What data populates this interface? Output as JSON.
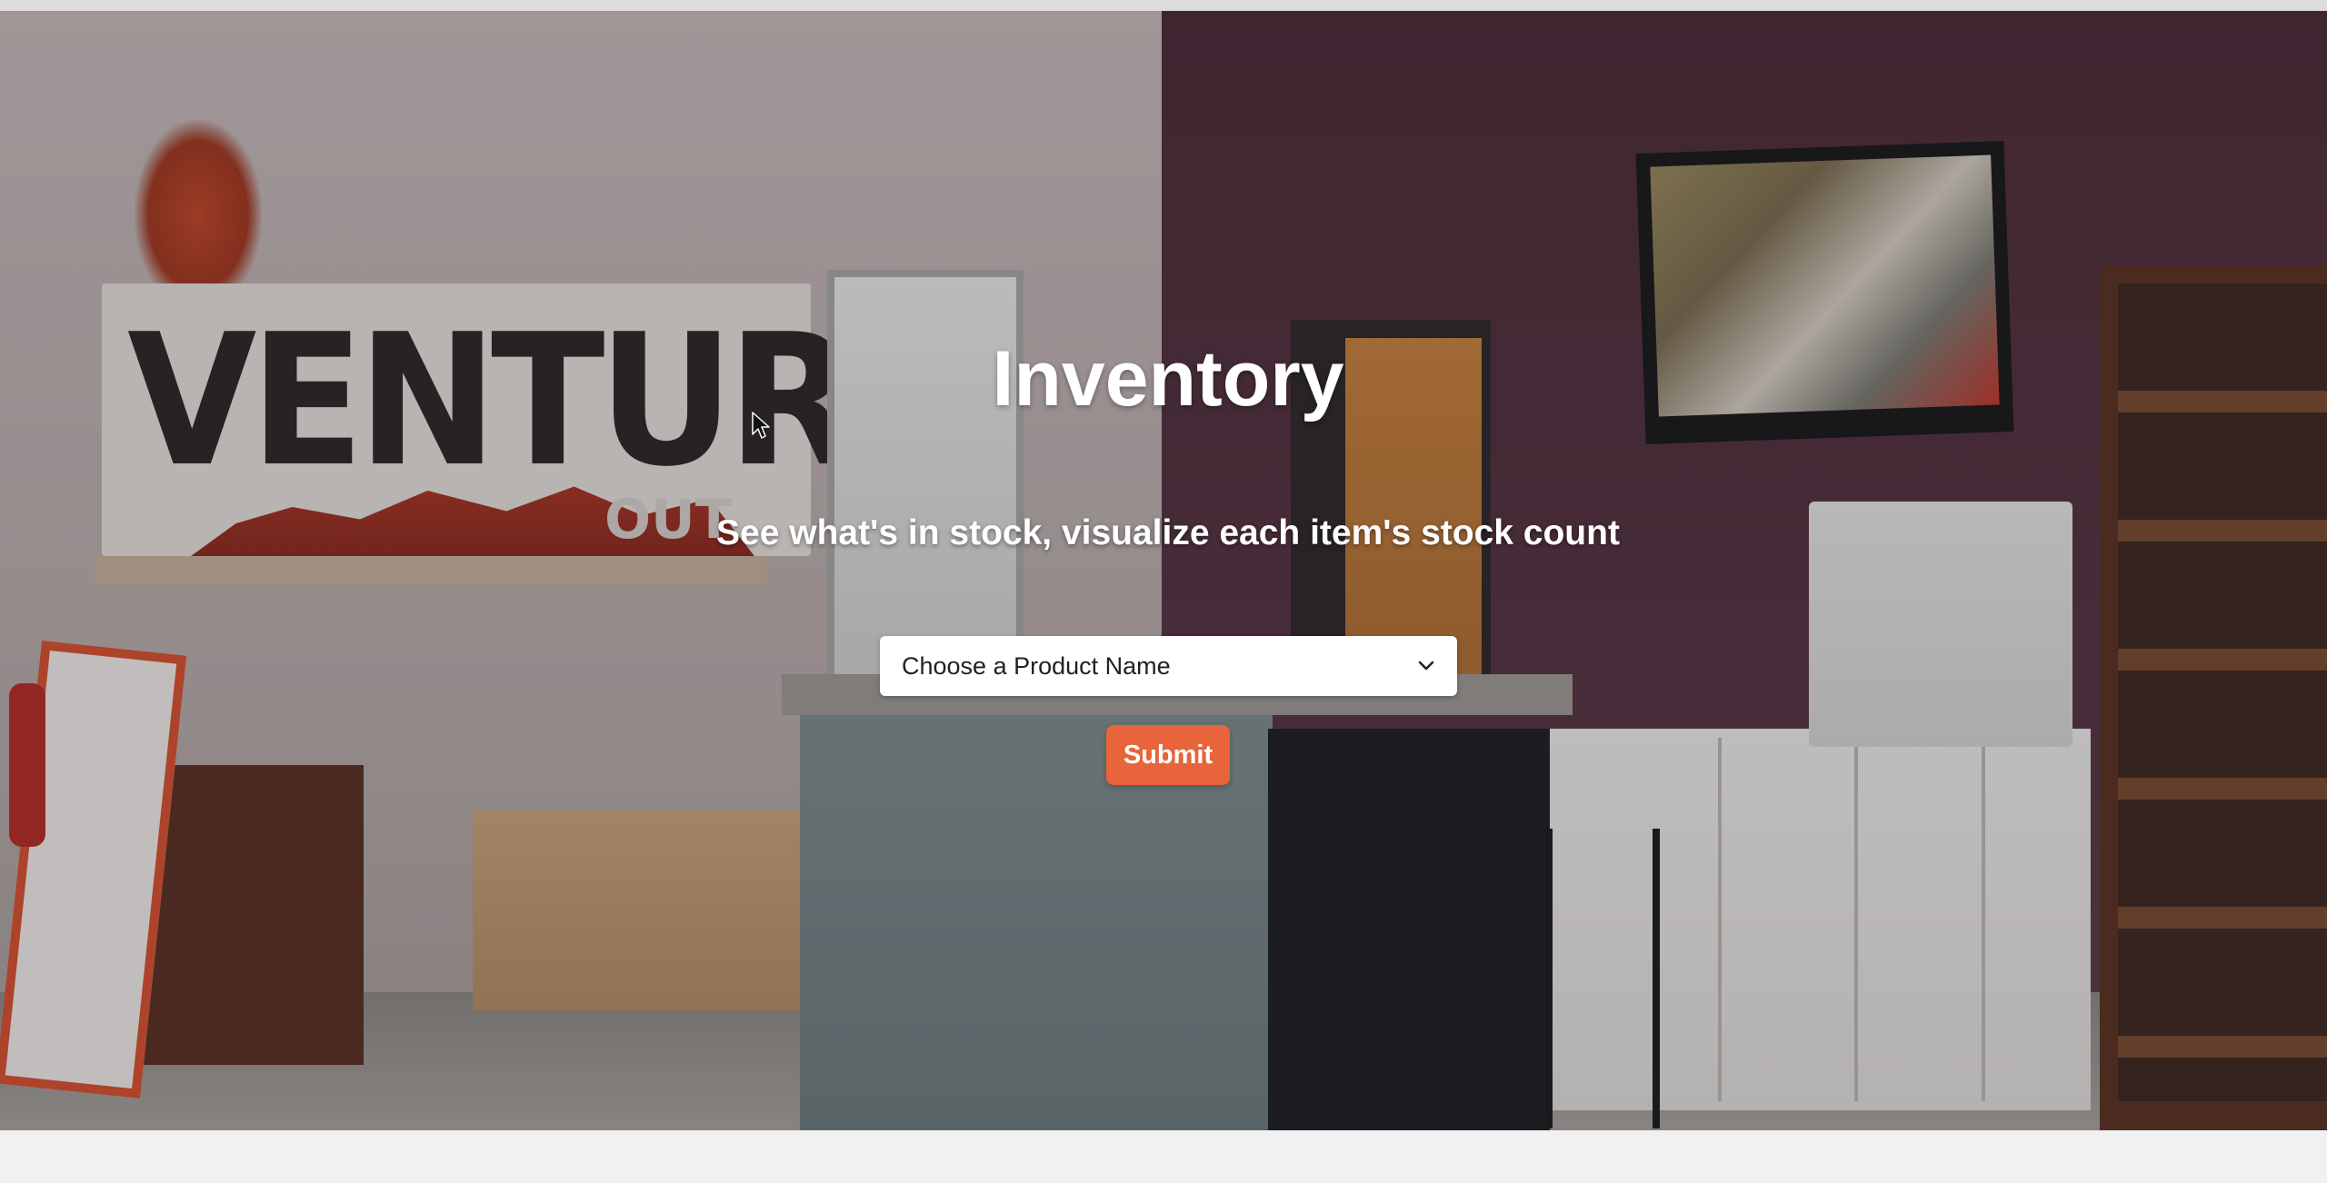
{
  "hero": {
    "title": "Inventory",
    "subtitle": "See what's in stock, visualize each item's stock count",
    "background": {
      "description_icon": "store-interior-photo",
      "sign_text": "VENTURE",
      "sign_subtext": "OUT"
    }
  },
  "form": {
    "product_select": {
      "selected_label": "Choose a Product Name",
      "icon": "chevron-down-icon"
    },
    "submit_label": "Submit"
  },
  "colors": {
    "accent": "#e8643a",
    "title_text": "#ffffff",
    "page_background": "#e9e9ea"
  }
}
